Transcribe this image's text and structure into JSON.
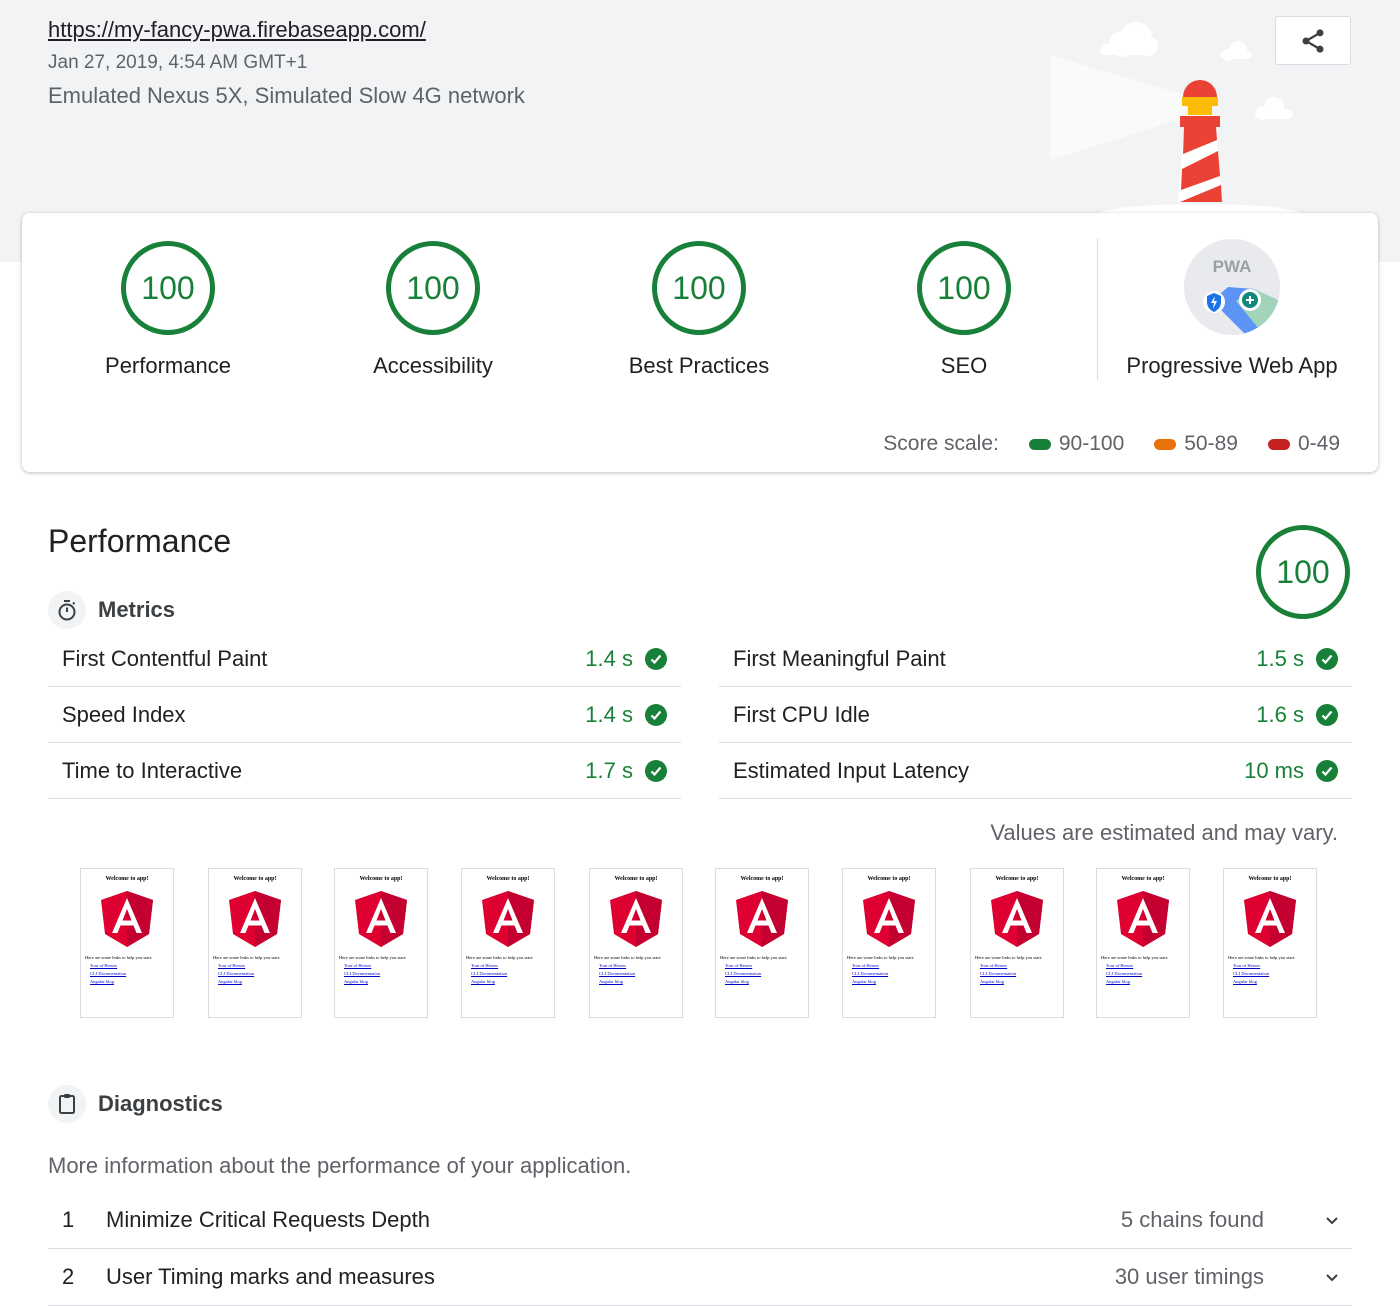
{
  "header": {
    "url": "https://my-fancy-pwa.firebaseapp.com/",
    "date": "Jan 27, 2019, 4:54 AM GMT+1",
    "environment": "Emulated Nexus 5X, Simulated Slow 4G network",
    "share_icon": "share-icon"
  },
  "categories": [
    {
      "score": "100",
      "label": "Performance",
      "color": "#188038"
    },
    {
      "score": "100",
      "label": "Accessibility",
      "color": "#188038"
    },
    {
      "score": "100",
      "label": "Best Practices",
      "color": "#188038"
    },
    {
      "score": "100",
      "label": "SEO",
      "color": "#188038"
    }
  ],
  "pwa": {
    "badge_text": "PWA",
    "label": "Progressive Web App"
  },
  "score_scale": {
    "label": "Score scale:",
    "ranges": [
      {
        "text": "90-100",
        "color": "#188038"
      },
      {
        "text": "50-89",
        "color": "#e8710a"
      },
      {
        "text": "0-49",
        "color": "#c5221f"
      }
    ]
  },
  "performance": {
    "title": "Performance",
    "score": "100",
    "metrics_title": "Metrics",
    "metrics": [
      {
        "name": "First Contentful Paint",
        "value": "1.4 s"
      },
      {
        "name": "First Meaningful Paint",
        "value": "1.5 s"
      },
      {
        "name": "Speed Index",
        "value": "1.4 s"
      },
      {
        "name": "First CPU Idle",
        "value": "1.6 s"
      },
      {
        "name": "Time to Interactive",
        "value": "1.7 s"
      },
      {
        "name": "Estimated Input Latency",
        "value": "10 ms"
      }
    ],
    "disclaimer": "Values are estimated and may vary.",
    "filmstrip": {
      "frame_title": "Welcome to app!",
      "frame_text": "Here are some links to help you start:",
      "links": [
        "Tour of Heroes",
        "CLI Documentation",
        "Angular blog"
      ]
    },
    "diagnostics_title": "Diagnostics",
    "diagnostics_desc": "More information about the performance of your application.",
    "audits": [
      {
        "num": "1",
        "title": "Minimize Critical Requests Depth",
        "display": "5 chains found"
      },
      {
        "num": "2",
        "title": "User Timing marks and measures",
        "display": "30 user timings"
      }
    ]
  }
}
